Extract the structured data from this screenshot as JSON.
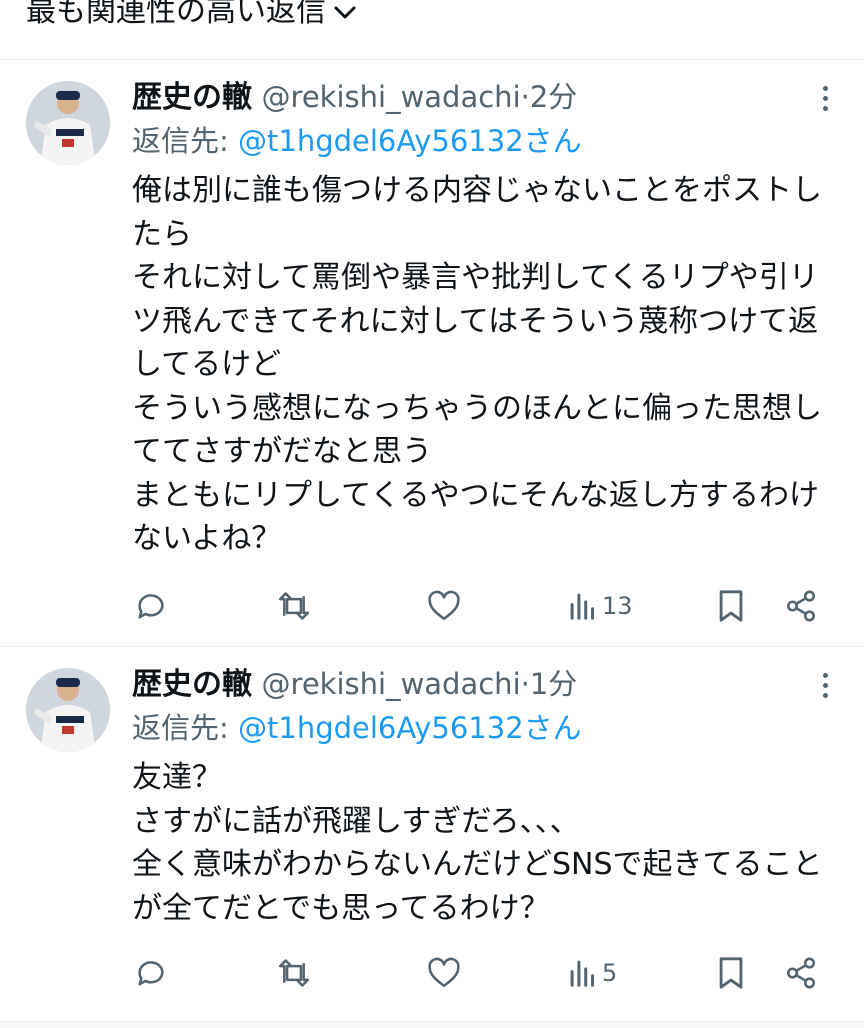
{
  "sort": {
    "label": "最も関連性の高い返信"
  },
  "tweets": [
    {
      "display_name": "歴史の轍",
      "handle": "@rekishi_wadachi",
      "dot": "·",
      "time": "2分",
      "reply_prefix": "返信先: ",
      "reply_to": "@t1hgdel6Ay56132さん",
      "text": "俺は別に誰も傷つける内容じゃないことをポストしたら\nそれに対して罵倒や暴言や批判してくるリプや引リツ飛んできてそれに対してはそういう蔑称つけて返してるけど\nそういう感想になっちゃうのほんとに偏った思想しててさすがだなと思う\nまともにリプしてくるやつにそんな返し方するわけないよね？",
      "views": "13"
    },
    {
      "display_name": "歴史の轍",
      "handle": "@rekishi_wadachi",
      "dot": "·",
      "time": "1分",
      "reply_prefix": "返信先: ",
      "reply_to": "@t1hgdel6Ay56132さん",
      "text": "友達？\nさすがに話が飛躍しすぎだろ、、、\n全く意味がわからないんだけどSNSで起きてることが全てだとでも思ってるわけ？",
      "views": "5"
    }
  ],
  "colors": {
    "link": "#1d9bf0",
    "secondary": "#536471",
    "text": "#0f1419"
  },
  "icons": [
    "chevron-down-icon",
    "more-icon",
    "reply-icon",
    "retweet-icon",
    "like-icon",
    "views-icon",
    "bookmark-icon",
    "share-icon"
  ]
}
